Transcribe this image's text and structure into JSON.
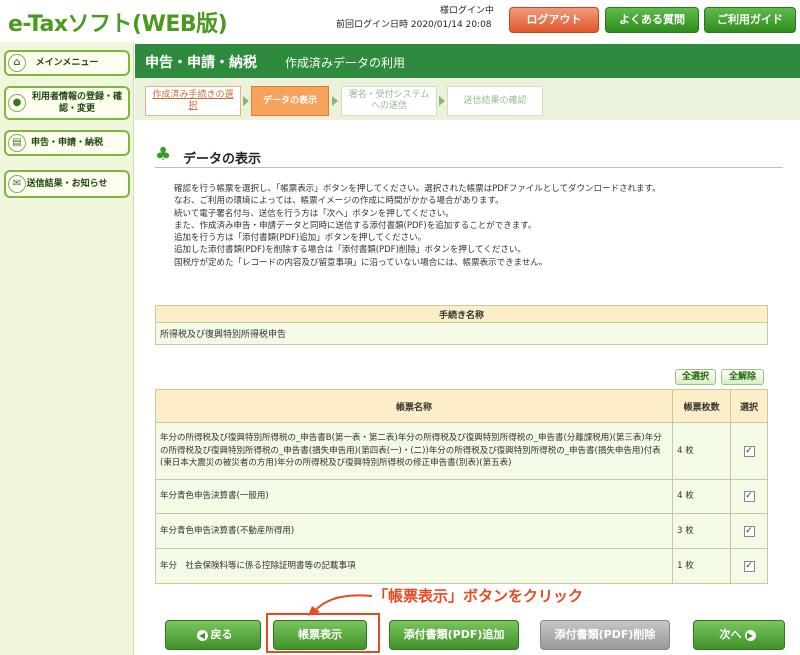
{
  "header": {
    "logo": "e-Taxソフト(WEB版)",
    "login_status": "様ログイン中",
    "last_login": "前回ログイン日時 2020/01/14 20:08",
    "logout": "ログアウト",
    "faq": "よくある質問",
    "guide": "ご利用ガイド"
  },
  "sidebar": {
    "items": [
      {
        "label": "メインメニュー",
        "icon": "home-icon"
      },
      {
        "label": "利用者情報の登録・確認・変更",
        "icon": "user-icon"
      },
      {
        "label": "申告・申請・納税",
        "icon": "document-icon"
      },
      {
        "label": "送信結果・お知らせ",
        "icon": "mail-icon"
      }
    ]
  },
  "titlebar": {
    "title": "申告・申請・納税",
    "subtitle": "作成済みデータの利用"
  },
  "steps": [
    {
      "label": "作成済み手続きの選択",
      "state": "done"
    },
    {
      "label": "データの表示",
      "state": "current"
    },
    {
      "label": "署名・受付システムへの送信",
      "state": "todo"
    },
    {
      "label": "送信結果の確認",
      "state": "todo"
    }
  ],
  "section": {
    "title": "データの表示"
  },
  "description": [
    "確認を行う帳票を選択し、「帳票表示」ボタンを押してください。選択された帳票はPDFファイルとしてダウンロードされます。",
    "なお、ご利用の環境によっては、帳票イメージの作成に時間がかかる場合があります。",
    "続いて電子署名付与、送信を行う方は「次へ」ボタンを押してください。",
    "また、作成済み申告・申請データと同時に送信する添付書類(PDF)を追加することができます。",
    "追加を行う方は「添付書類(PDF)追加」ボタンを押してください。",
    "追加した添付書類(PDF)を削除する場合は「添付書類(PDF)削除」ボタンを押してください。",
    "国税庁が定めた「レコードの内容及び留意事項」に沿っていない場合には、帳票表示できません。"
  ],
  "procedure_table": {
    "header": "手続き名称",
    "value": "所得税及び復興特別所得税申告"
  },
  "select_buttons": {
    "select_all": "全選択",
    "deselect_all": "全解除"
  },
  "forms_table": {
    "headers": [
      "帳票名称",
      "帳票枚数",
      "選択"
    ],
    "rows": [
      {
        "name": "年分の所得税及び復興特別所得税の_申告書B(第一表・第二表)年分の所得税及び復興特別所得税の_申告書(分離課税用)(第三表)年分の所得税及び復興特別所得税の_申告書(損失申告用)(第四表(一)・(二))年分の所得税及び復興特別所得税の_申告書(損失申告用)付表(東日本大震災の被災者の方用)年分の所得税及び復興特別所得税の修正申告書(別表)(第五表)",
        "count": "4 枚",
        "checked": true
      },
      {
        "name": "年分青色申告決算書(一般用)",
        "count": "4 枚",
        "checked": true
      },
      {
        "name": "年分青色申告決算書(不動産所得用)",
        "count": "3 枚",
        "checked": true
      },
      {
        "name": "年分　社会保険料等に係る控除証明書等の記載事項",
        "count": "1 枚",
        "checked": true
      }
    ]
  },
  "annotation": "「帳票表示」ボタンをクリック",
  "bottom_buttons": {
    "back": "戻る",
    "show": "帳票表示",
    "add_pdf": "添付書類(PDF)追加",
    "delete_pdf": "添付書類(PDF)削除",
    "next": "次へ"
  },
  "colors": {
    "brand_green": "#2e8a3c",
    "accent_orange": "#f5a25d",
    "annotation_red": "#e8491f"
  }
}
